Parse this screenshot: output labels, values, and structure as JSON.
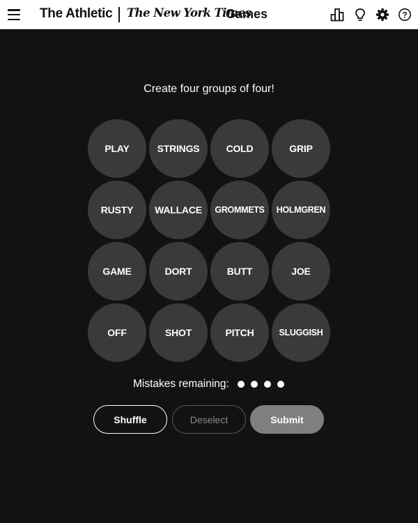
{
  "header": {
    "brand_athletic": "The Athletic",
    "brand_nyt": "The New York Times",
    "brand_games": "Games"
  },
  "game": {
    "prompt": "Create four groups of four!",
    "tiles": [
      "PLAY",
      "STRINGS",
      "COLD",
      "GRIP",
      "RUSTY",
      "WALLACE",
      "GROMMETS",
      "HOLMGREN",
      "GAME",
      "DORT",
      "BUTT",
      "JOE",
      "OFF",
      "SHOT",
      "PITCH",
      "SLUGGISH"
    ],
    "mistakes_label": "Mistakes remaining:",
    "mistakes_remaining": 4,
    "buttons": {
      "shuffle": "Shuffle",
      "deselect": "Deselect",
      "submit": "Submit"
    }
  },
  "colors": {
    "background": "#121212",
    "tile": "#3a3a3a",
    "submit_disabled": "#7f7f7f"
  }
}
